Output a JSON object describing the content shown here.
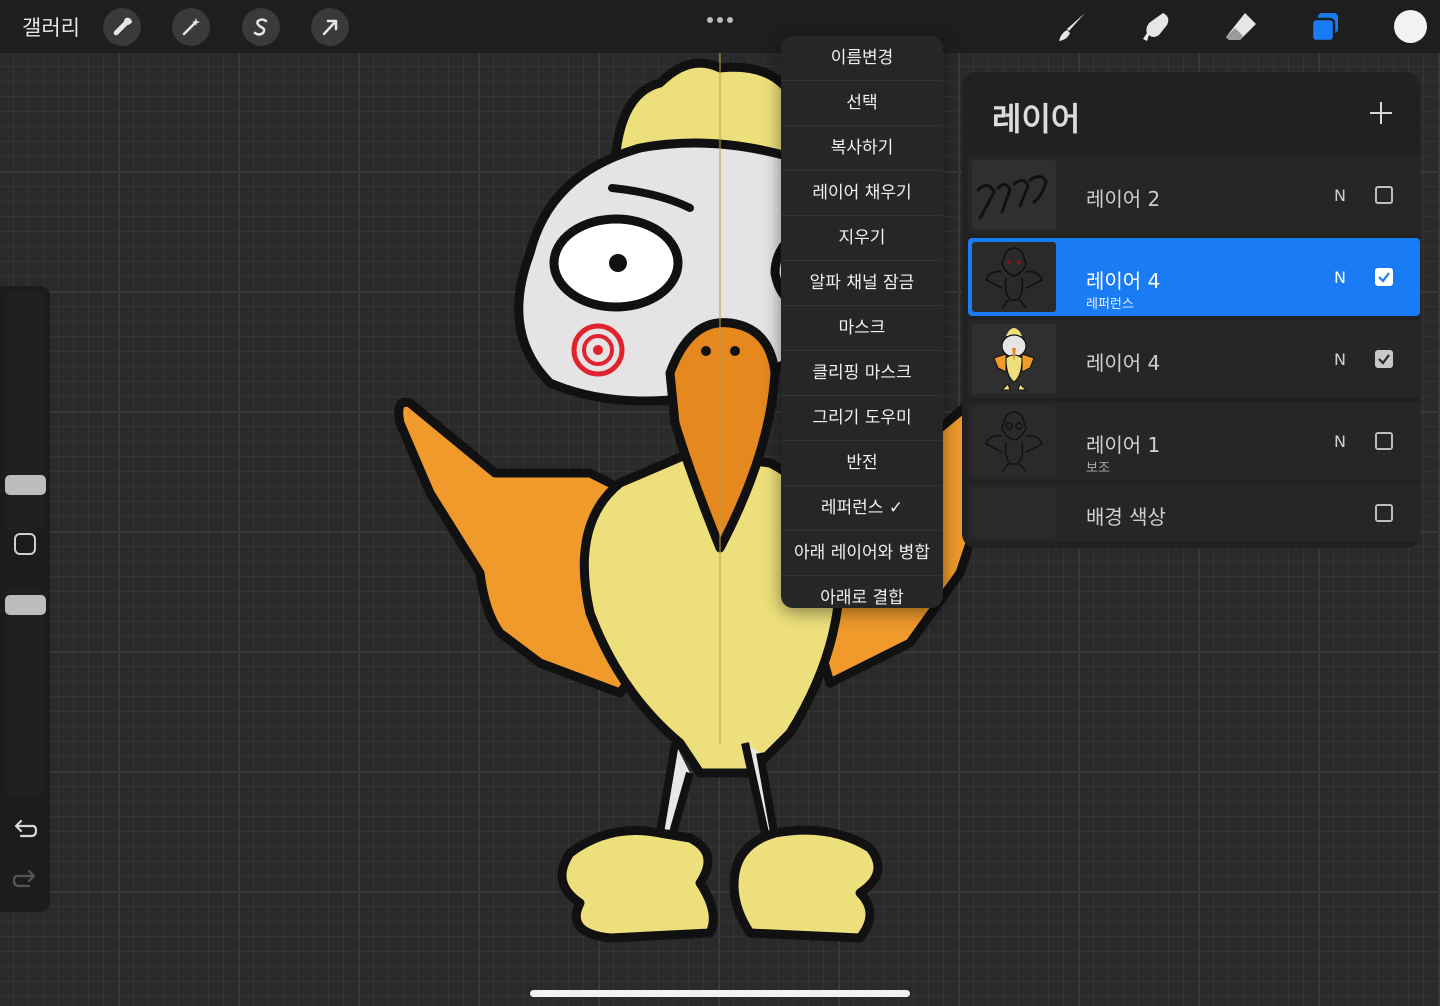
{
  "topbar": {
    "gallery_label": "갤러리",
    "left_tools": [
      "wrench-icon",
      "magic-wand-icon",
      "selection-s-icon",
      "transform-arrow-icon"
    ],
    "right_tools": [
      "brush-icon",
      "smudge-icon",
      "eraser-icon",
      "layers-icon"
    ],
    "active_tool": "layers-icon",
    "current_color": "#f2f2f2"
  },
  "context_menu": {
    "items": [
      {
        "label": "이름변경"
      },
      {
        "label": "선택"
      },
      {
        "label": "복사하기"
      },
      {
        "label": "레이어 채우기"
      },
      {
        "label": "지우기"
      },
      {
        "label": "알파 채널 잠금"
      },
      {
        "label": "마스크"
      },
      {
        "label": "클리핑 마스크"
      },
      {
        "label": "그리기 도우미"
      },
      {
        "label": "반전"
      },
      {
        "label": "레퍼런스 ✓"
      },
      {
        "label": "아래 레이어와 병합"
      },
      {
        "label": "아래로 결합"
      }
    ]
  },
  "layers_panel": {
    "title": "레이어",
    "layers": [
      {
        "name": "레이어 2",
        "sub": "",
        "blend": "N",
        "visible": false,
        "active": false,
        "thumb": "scribble"
      },
      {
        "name": "레이어 4",
        "sub": "레퍼런스",
        "blend": "N",
        "visible": true,
        "active": true,
        "thumb": "bird-outline-dark"
      },
      {
        "name": "레이어 4",
        "sub": "",
        "blend": "N",
        "visible": true,
        "active": false,
        "thumb": "bird-color"
      },
      {
        "name": "레이어 1",
        "sub": "보조",
        "blend": "N",
        "visible": false,
        "active": false,
        "thumb": "bird-outline"
      },
      {
        "name": "배경 색상",
        "sub": "",
        "blend": "",
        "visible": false,
        "active": false,
        "thumb": "background"
      }
    ]
  },
  "colors": {
    "accent": "#1a7cf5",
    "background": "#2b2b2b"
  }
}
